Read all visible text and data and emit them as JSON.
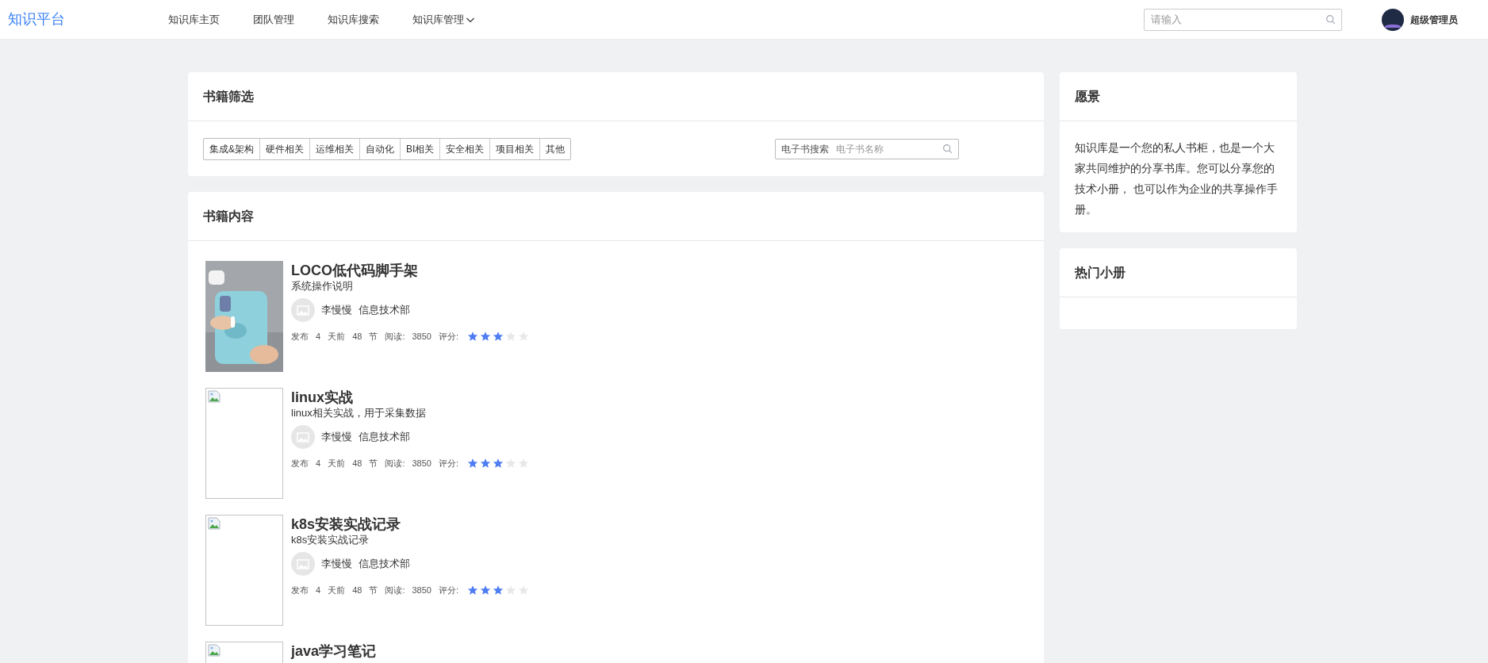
{
  "nav": {
    "logo": "知识平台",
    "items": [
      {
        "label": "知识库主页",
        "kind": "link"
      },
      {
        "label": "团队管理",
        "kind": "link"
      },
      {
        "label": "知识库搜索",
        "kind": "link"
      },
      {
        "label": "知识库管理",
        "kind": "dropdown"
      }
    ],
    "search": {
      "placeholder": "请输入"
    },
    "user": {
      "name": "超级管理员"
    }
  },
  "filter": {
    "title": "书籍筛选",
    "categories": [
      "集成&架构",
      "硬件相关",
      "运维相关",
      "自动化",
      "BI相关",
      "安全相关",
      "项目相关",
      "其他"
    ],
    "search": {
      "label": "电子书搜索",
      "placeholder": "电子书名称"
    }
  },
  "books": {
    "title": "书籍内容",
    "items": [
      {
        "title": "LOCO低代码脚手架",
        "description": "系统操作说明",
        "author": "李慢慢",
        "department": "信息技术部",
        "meta": [
          "发布",
          "4",
          "天前",
          "48",
          "节",
          "阅读:",
          "3850",
          "评分:"
        ],
        "stars": 3
      },
      {
        "cover": {
          "kind": "broken"
        },
        "title": "linux实战",
        "description": "linux相关实战，用于采集数据",
        "author": "李慢慢",
        "department": "信息技术部",
        "meta": [
          "发布",
          "4",
          "天前",
          "48",
          "节",
          "阅读:",
          "3850",
          "评分:"
        ],
        "stars": 3
      },
      {
        "cover": {
          "kind": "broken"
        },
        "title": "k8s安装实战记录",
        "description": "k8s安装实战记录",
        "author": "李慢慢",
        "department": "信息技术部",
        "meta": [
          "发布",
          "4",
          "天前",
          "48",
          "节",
          "阅读:",
          "3850",
          "评分:"
        ],
        "stars": 3
      },
      {
        "cover": {
          "kind": "broken"
        },
        "title": "java学习笔记"
      }
    ]
  },
  "vision": {
    "title": "愿景",
    "text": "知识库是一个您的私人书柜，也是一个大家共同维护的分享书库。您可以分享您的技术小册， 也可以作为企业的共享操作手册。"
  },
  "hot": {
    "title": "热门小册"
  }
}
